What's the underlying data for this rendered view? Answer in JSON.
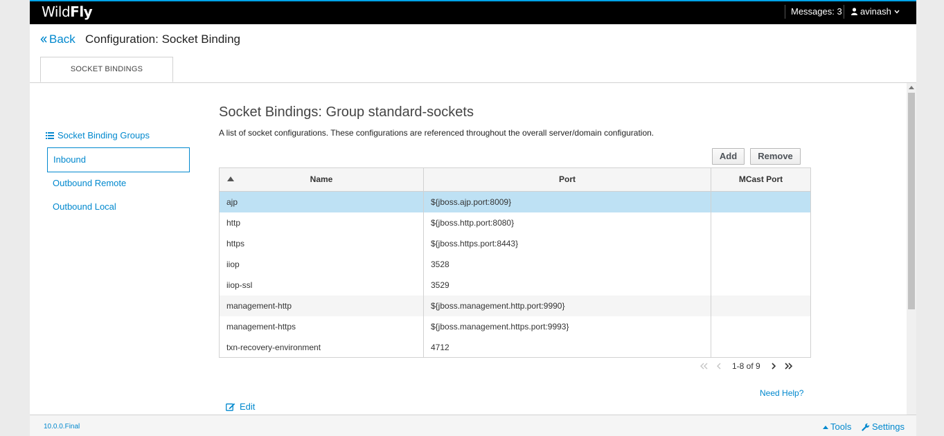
{
  "topbar": {
    "brand_light": "Wild",
    "brand_bold": "Fly",
    "messages": "Messages: 3",
    "user": "avinash"
  },
  "header": {
    "back_label": "Back",
    "title": "Configuration: Socket Binding",
    "tab": "SOCKET BINDINGS"
  },
  "sidebar": {
    "heading": "Socket Binding Groups",
    "items": [
      {
        "label": "Inbound",
        "active": true
      },
      {
        "label": "Outbound Remote",
        "active": false
      },
      {
        "label": "Outbound Local",
        "active": false
      }
    ]
  },
  "main": {
    "title": "Socket Bindings: Group standard-sockets",
    "description": "A list of socket configurations. These configurations are referenced throughout the overall server/domain configuration.",
    "add_label": "Add",
    "remove_label": "Remove",
    "table": {
      "columns": [
        "Name",
        "Port",
        "MCast Port"
      ],
      "rows": [
        {
          "name": "ajp",
          "port": "${jboss.ajp.port:8009}",
          "mcast": ""
        },
        {
          "name": "http",
          "port": "${jboss.http.port:8080}",
          "mcast": ""
        },
        {
          "name": "https",
          "port": "${jboss.https.port:8443}",
          "mcast": ""
        },
        {
          "name": "iiop",
          "port": "3528",
          "mcast": ""
        },
        {
          "name": "iiop-ssl",
          "port": "3529",
          "mcast": ""
        },
        {
          "name": "management-http",
          "port": "${jboss.management.http.port:9990}",
          "mcast": ""
        },
        {
          "name": "management-https",
          "port": "${jboss.management.https.port:9993}",
          "mcast": ""
        },
        {
          "name": "txn-recovery-environment",
          "port": "4712",
          "mcast": ""
        }
      ]
    },
    "pager": "1-8 of 9",
    "need_help": "Need Help?",
    "edit_label": "Edit"
  },
  "footer": {
    "version": "10.0.0.Final",
    "tools": "Tools",
    "settings": "Settings"
  },
  "colors": {
    "accent": "#0088ce",
    "selected_row": "#bee1f4",
    "topbar_border": "#00a3e8"
  }
}
